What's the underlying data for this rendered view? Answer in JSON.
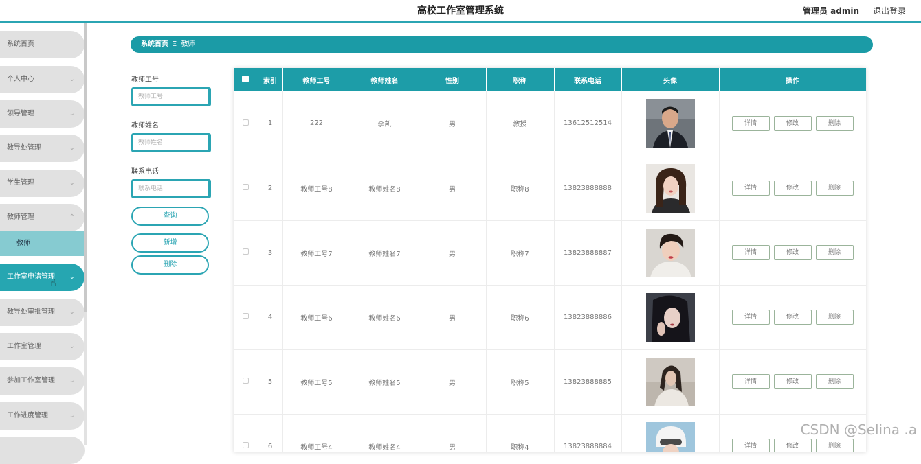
{
  "header": {
    "title": "高校工作室管理系统",
    "admin": "管理员 admin",
    "logout": "退出登录"
  },
  "sidebar": {
    "items": [
      {
        "label": "系统首页",
        "chevron": ""
      },
      {
        "label": "个人中心",
        "chevron": "⌄"
      },
      {
        "label": "领导管理",
        "chevron": "⌄"
      },
      {
        "label": "教导处管理",
        "chevron": "⌄"
      },
      {
        "label": "学生管理",
        "chevron": "⌄"
      },
      {
        "label": "教师管理",
        "chevron": "⌃"
      },
      {
        "label": "工作室申请管理",
        "chevron": "⌄"
      },
      {
        "label": "教导处审批管理",
        "chevron": "⌄"
      },
      {
        "label": "工作室管理",
        "chevron": "⌄"
      },
      {
        "label": "参加工作室管理",
        "chevron": "⌄"
      },
      {
        "label": "工作进度管理",
        "chevron": "⌄"
      }
    ],
    "submenu": "教师"
  },
  "breadcrumb": {
    "home": "系统首页",
    "separator": "Ξ",
    "current": "教师"
  },
  "search": {
    "fields": [
      {
        "label": "教师工号",
        "placeholder": "教师工号"
      },
      {
        "label": "教师姓名",
        "placeholder": "教师姓名"
      },
      {
        "label": "联系电话",
        "placeholder": "联系电话"
      }
    ],
    "query_btn": "查询",
    "add_btn": "新增",
    "delete_btn": "删除"
  },
  "table": {
    "headers": [
      "索引",
      "教师工号",
      "教师姓名",
      "性别",
      "职称",
      "联系电话",
      "头像",
      "操作"
    ],
    "rows": [
      {
        "index": "1",
        "id": "222",
        "name": "李凯",
        "gender": "男",
        "title": "教授",
        "phone": "13612512514"
      },
      {
        "index": "2",
        "id": "教师工号8",
        "name": "教师姓名8",
        "gender": "男",
        "title": "职称8",
        "phone": "13823888888"
      },
      {
        "index": "3",
        "id": "教师工号7",
        "name": "教师姓名7",
        "gender": "男",
        "title": "职称7",
        "phone": "13823888887"
      },
      {
        "index": "4",
        "id": "教师工号6",
        "name": "教师姓名6",
        "gender": "男",
        "title": "职称6",
        "phone": "13823888886"
      },
      {
        "index": "5",
        "id": "教师工号5",
        "name": "教师姓名5",
        "gender": "男",
        "title": "职称5",
        "phone": "13823888885"
      },
      {
        "index": "6",
        "id": "教师工号4",
        "name": "教师姓名4",
        "gender": "男",
        "title": "职称4",
        "phone": "13823888884"
      }
    ],
    "ops": {
      "detail": "详情",
      "edit": "修改",
      "delete": "删除"
    }
  },
  "watermark": "CSDN @Selina .a",
  "colors": {
    "accent": "#2ba5b3",
    "header_bg": "#1d9da8"
  }
}
